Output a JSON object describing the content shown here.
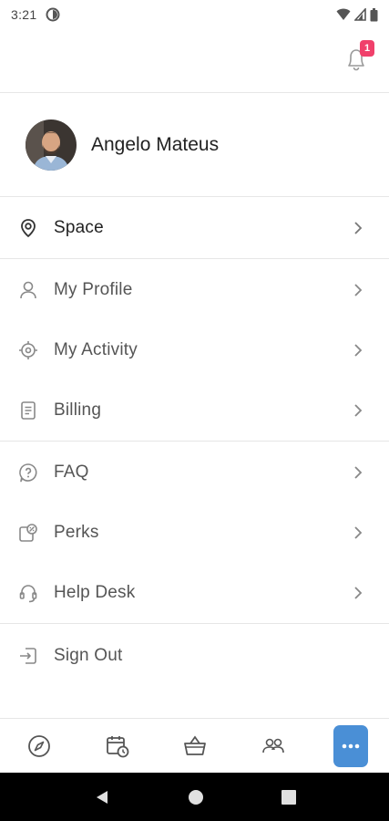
{
  "status_bar": {
    "time": "3:21"
  },
  "header": {
    "notification_count": "1"
  },
  "profile": {
    "name": "Angelo Mateus"
  },
  "menu": {
    "space": {
      "label": "Space"
    },
    "my_profile": {
      "label": "My Profile"
    },
    "my_activity": {
      "label": "My Activity"
    },
    "billing": {
      "label": "Billing"
    },
    "faq": {
      "label": "FAQ"
    },
    "perks": {
      "label": "Perks"
    },
    "help_desk": {
      "label": "Help Desk"
    },
    "sign_out": {
      "label": "Sign Out"
    }
  },
  "bottom_nav": {
    "items": [
      "compass-icon",
      "calendar-clock-icon",
      "basket-icon",
      "people-icon",
      "more-icon"
    ],
    "active": "more-icon"
  },
  "colors": {
    "accent": "#4a8fd6",
    "badge": "#f0406b",
    "divider": "#e6e6e6"
  }
}
